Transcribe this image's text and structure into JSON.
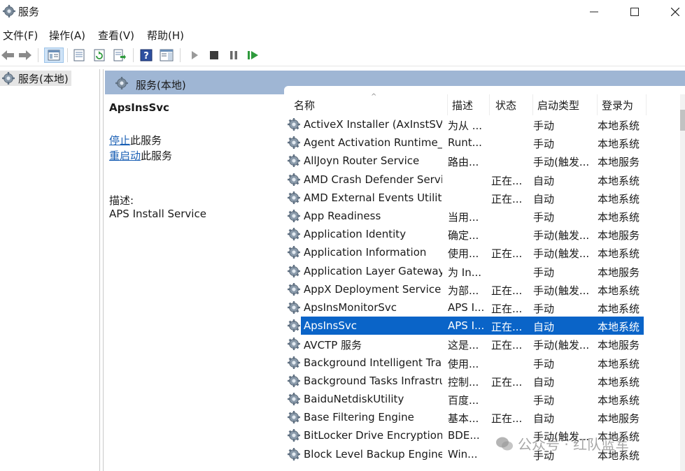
{
  "window": {
    "title": "服务"
  },
  "menubar": {
    "items": [
      "文件(F)",
      "操作(A)",
      "查看(V)",
      "帮助(H)"
    ]
  },
  "tree": {
    "root_label": "服务(本地)"
  },
  "panel": {
    "header_title": "服务(本地)"
  },
  "details": {
    "service_name": "ApsInsSvc",
    "stop_link": "停止",
    "stop_suffix": "此服务",
    "restart_link": "重启动",
    "restart_suffix": "此服务",
    "desc_label": "描述:",
    "desc_text": "APS Install Service"
  },
  "columns": {
    "name": "名称",
    "desc": "描述",
    "status": "状态",
    "startup": "启动类型",
    "logon": "登录为"
  },
  "rows": [
    {
      "name": "ActiveX Installer (AxInstSV)",
      "desc": "为从 ...",
      "status": "",
      "startup": "手动",
      "logon": "本地系统"
    },
    {
      "name": "Agent Activation Runtime_...",
      "desc": "Runt...",
      "status": "",
      "startup": "手动",
      "logon": "本地系统"
    },
    {
      "name": "AllJoyn Router Service",
      "desc": "路由...",
      "status": "",
      "startup": "手动(触发...",
      "logon": "本地服务"
    },
    {
      "name": "AMD Crash Defender Servi...",
      "desc": "",
      "status": "正在...",
      "startup": "自动",
      "logon": "本地系统"
    },
    {
      "name": "AMD External Events Utility",
      "desc": "",
      "status": "正在...",
      "startup": "自动",
      "logon": "本地系统"
    },
    {
      "name": "App Readiness",
      "desc": "当用...",
      "status": "",
      "startup": "手动",
      "logon": "本地系统"
    },
    {
      "name": "Application Identity",
      "desc": "确定...",
      "status": "",
      "startup": "手动(触发...",
      "logon": "本地服务"
    },
    {
      "name": "Application Information",
      "desc": "使用...",
      "status": "正在...",
      "startup": "手动(触发...",
      "logon": "本地系统"
    },
    {
      "name": "Application Layer Gateway ...",
      "desc": "为 In...",
      "status": "",
      "startup": "手动",
      "logon": "本地服务"
    },
    {
      "name": "AppX Deployment Service ...",
      "desc": "为部...",
      "status": "正在...",
      "startup": "手动(触发...",
      "logon": "本地系统"
    },
    {
      "name": "ApsInsMonitorSvc",
      "desc": "APS I...",
      "status": "正在...",
      "startup": "手动",
      "logon": "本地系统"
    },
    {
      "name": "ApsInsSvc",
      "desc": "APS I...",
      "status": "正在...",
      "startup": "自动",
      "logon": "本地系统",
      "selected": true
    },
    {
      "name": "AVCTP 服务",
      "desc": "这是...",
      "status": "正在...",
      "startup": "手动(触发...",
      "logon": "本地服务"
    },
    {
      "name": "Background Intelligent Tra...",
      "desc": "使用...",
      "status": "",
      "startup": "手动",
      "logon": "本地系统"
    },
    {
      "name": "Background Tasks Infrastru...",
      "desc": "控制...",
      "status": "正在...",
      "startup": "自动",
      "logon": "本地系统"
    },
    {
      "name": "BaiduNetdiskUtility",
      "desc": "百度...",
      "status": "",
      "startup": "手动",
      "logon": "本地系统"
    },
    {
      "name": "Base Filtering Engine",
      "desc": "基本...",
      "status": "正在...",
      "startup": "自动",
      "logon": "本地服务"
    },
    {
      "name": "BitLocker Drive Encryption ...",
      "desc": "BDE...",
      "status": "",
      "startup": "手动(触发...",
      "logon": "本地系统"
    },
    {
      "name": "Block Level Backup Engine ...",
      "desc": "Win...",
      "status": "",
      "startup": "手动",
      "logon": "本地系统"
    }
  ],
  "watermark": {
    "text": "公众号 · 红队蓝军"
  },
  "colors": {
    "header_band": "#9fb6d4",
    "selection": "#0a64c8",
    "link": "#1a5fb4"
  }
}
